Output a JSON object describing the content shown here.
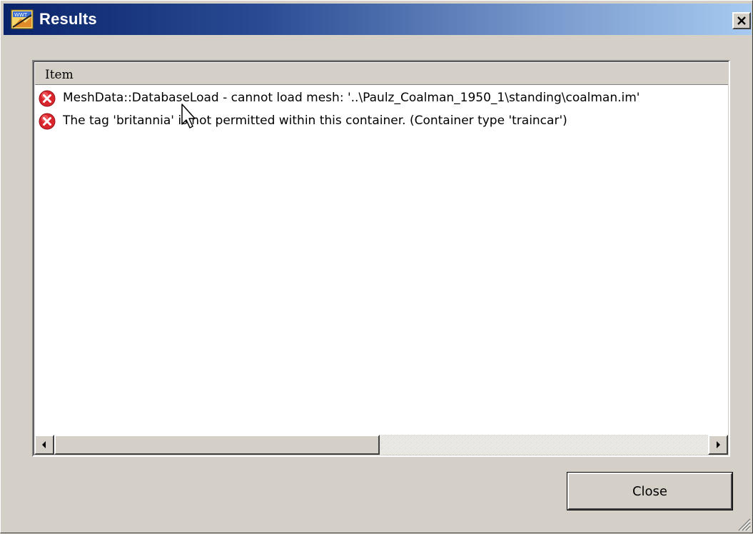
{
  "window": {
    "title": "Results",
    "icon": "app-icon",
    "close_icon": "close-x-icon"
  },
  "list": {
    "column_header": "Item",
    "rows": [
      {
        "icon": "error-icon",
        "text": "MeshData::DatabaseLoad - cannot load mesh: '..\\Paulz_Coalman_1950_1\\standing\\coalman.im'"
      },
      {
        "icon": "error-icon",
        "text": "The tag 'britannia' is not permitted within this container. (Container type 'traincar')"
      }
    ]
  },
  "footer": {
    "close_label": "Close"
  },
  "colors": {
    "title_gradient_start": "#0a246a",
    "title_gradient_end": "#a6caf0",
    "error_red": "#d9252c",
    "face": "#d4d0c8"
  }
}
